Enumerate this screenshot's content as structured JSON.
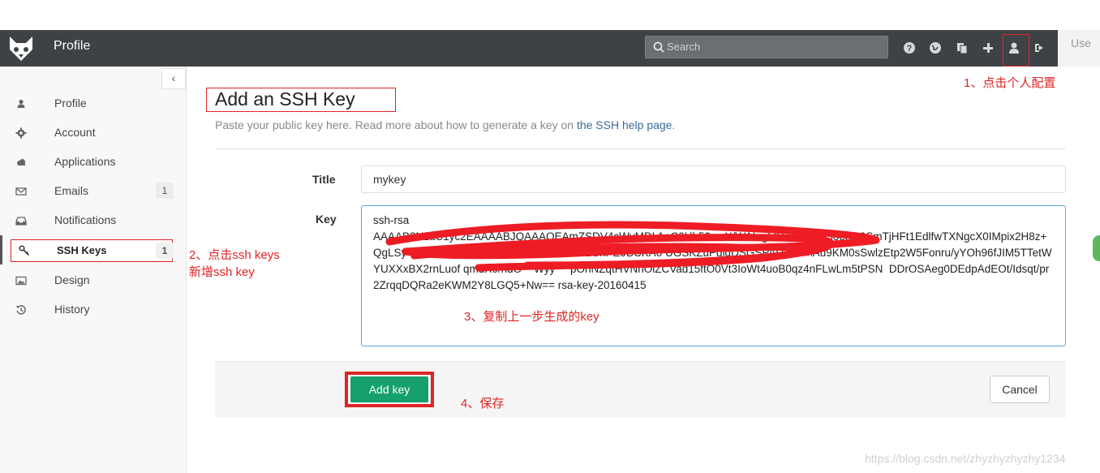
{
  "header": {
    "title": "Profile",
    "search_placeholder": "Search",
    "broken_image_alt": "Use",
    "icons": [
      "help-icon",
      "globe-icon",
      "copy-icon",
      "plus-icon",
      "user-icon",
      "sign-out-icon"
    ]
  },
  "sidebar": {
    "collapse_glyph": "‹",
    "items": [
      {
        "label": "Profile",
        "icon": "user-icon"
      },
      {
        "label": "Account",
        "icon": "gear-icon"
      },
      {
        "label": "Applications",
        "icon": "cloud-icon"
      },
      {
        "label": "Emails",
        "icon": "envelope-icon",
        "count": "1"
      },
      {
        "label": "Notifications",
        "icon": "inbox-icon"
      },
      {
        "label": "SSH Keys",
        "icon": "key-icon",
        "count": "1"
      },
      {
        "label": "Design",
        "icon": "image-icon"
      },
      {
        "label": "History",
        "icon": "history-icon"
      }
    ]
  },
  "main": {
    "heading": "Add an SSH Key",
    "subtitle_text": "Paste your public key here. Read more about how to generate a key on ",
    "subtitle_link": "the SSH help page",
    "subtitle_end": ".",
    "title_label": "Title",
    "title_value": "mykey",
    "key_label": "Key",
    "key_value": "ssh-rsa\nAAAAB3NzaC1yc2EAAAABJQAAAQEAmZSDV4cWvMDL1+C0Hb52+wX/WAInghtVZI8znDS5oehG0SmTjHFt1EdlfwTXNgcX0IMpix2H8z+  QgLSy  ylo  uJ  Pl  3 5  N  3  TZ  YOBmAa+LGnPE9BCKA0 UGSKZuPgjdDSGSPAUzC+mAu9KM0sSwlzEtp2W5Fonru/yYOh96fJIM5TTetWYUXXxBX2rnLuof qmdX0/hdO    Wyy     pOnNZqtHVNnOlZCVad15ftO0Vt3IoWt4uoB0qz4nFLwLm5tPSN  DDrOSAeg0DEdpAdEOt/Idsqt/pr2ZrqqDQRa2eKWM2Y8LGQ5+Nw== rsa-key-20160415",
    "add_button": "Add key",
    "cancel_button": "Cancel"
  },
  "annotations": {
    "step1": "1、点击个人配置",
    "step2a": "2、点击ssh keys",
    "step2b": "新增ssh key",
    "step3": "3、复制上一步生成的key",
    "step4": "4、保存"
  },
  "watermark": "https://blog.csdn.net/zhyzhyzhyzhy1234",
  "colors": {
    "header_bg": "#3d4246",
    "annotation_red": "#e02424",
    "add_button_green": "#16a06b"
  }
}
